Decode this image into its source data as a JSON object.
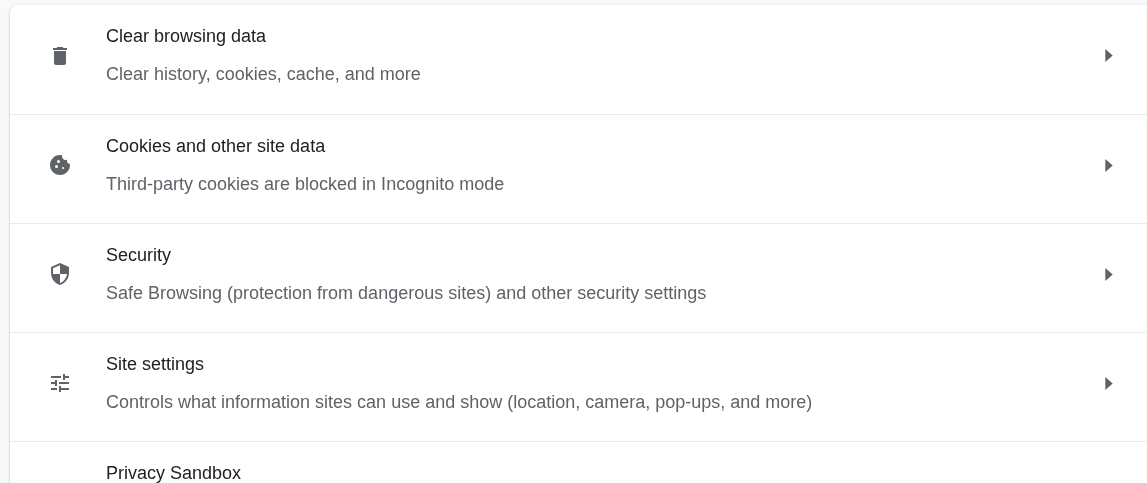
{
  "rows": [
    {
      "title": "Clear browsing data",
      "subtitle": "Clear history, cookies, cache, and more"
    },
    {
      "title": "Cookies and other site data",
      "subtitle": "Third-party cookies are blocked in Incognito mode"
    },
    {
      "title": "Security",
      "subtitle": "Safe Browsing (protection from dangerous sites) and other security settings"
    },
    {
      "title": "Site settings",
      "subtitle": "Controls what information sites can use and show (location, camera, pop-ups, and more)"
    },
    {
      "title": "Privacy Sandbox"
    }
  ]
}
